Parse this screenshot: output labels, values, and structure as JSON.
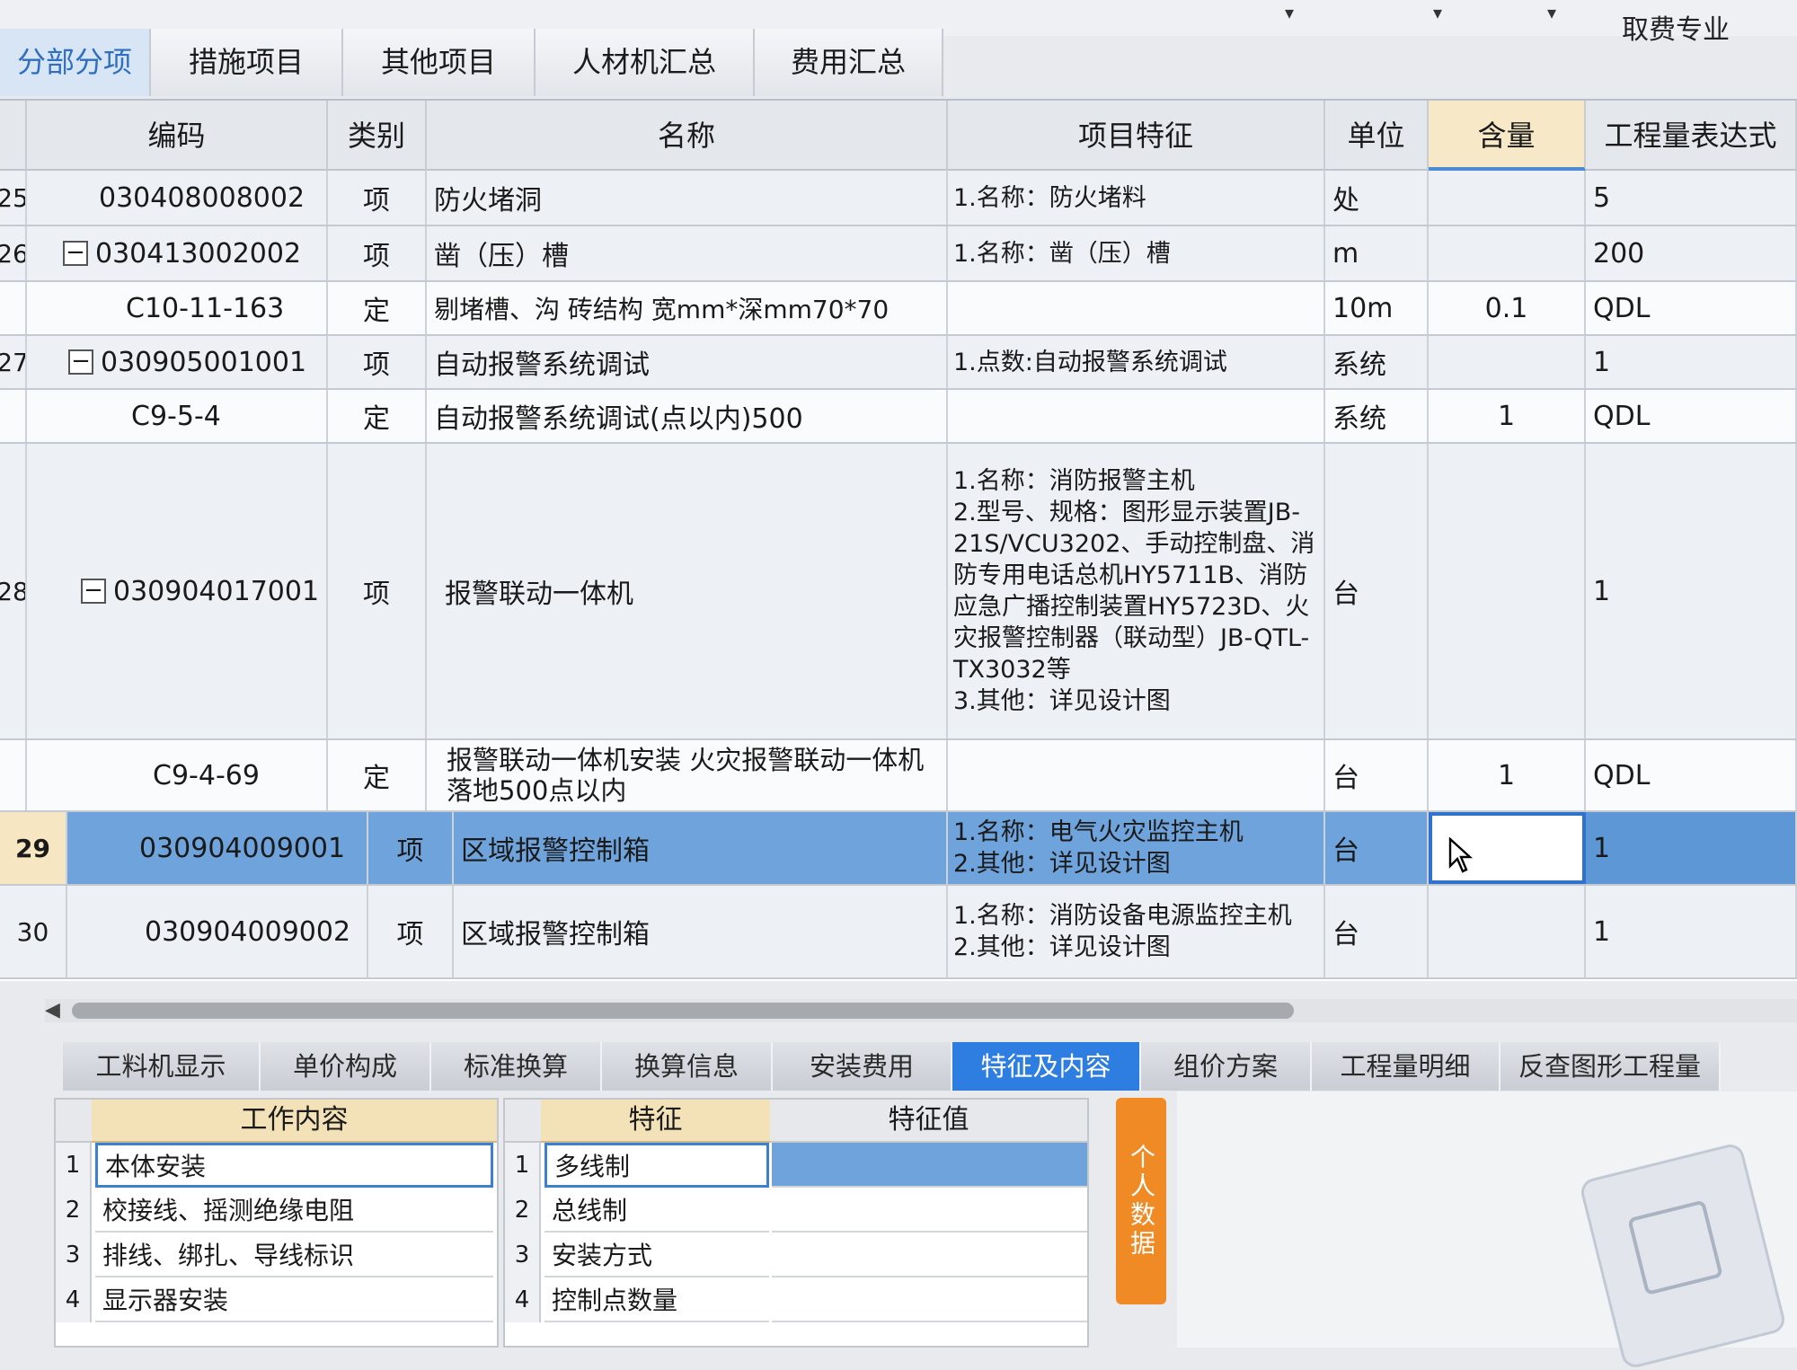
{
  "top": {
    "fee_label": "取费专业"
  },
  "tabs": [
    {
      "label": "分部分项",
      "active": true
    },
    {
      "label": "措施项目"
    },
    {
      "label": "其他项目"
    },
    {
      "label": "人材机汇总"
    },
    {
      "label": "费用汇总"
    }
  ],
  "table": {
    "headers": {
      "code": "编码",
      "type": "类别",
      "name": "名称",
      "feature": "项目特征",
      "unit": "单位",
      "content": "含量",
      "expr": "工程量表达式"
    },
    "rows": [
      {
        "num": "25",
        "code": "030408008002",
        "type": "项",
        "name": "防火堵洞",
        "feature": "1.名称：防火堵料",
        "unit": "处",
        "content": "",
        "expr": "5"
      },
      {
        "num": "26",
        "code": "030413002002",
        "type": "项",
        "name": "凿（压）槽",
        "feature": "1.名称：凿（压）槽",
        "unit": "m",
        "content": "",
        "expr": "200"
      },
      {
        "num": "",
        "code": "C10-11-163",
        "type": "定",
        "name": "剔堵槽、沟 砖结构 宽mm*深mm70*70",
        "feature": "",
        "unit": "10m",
        "content": "0.1",
        "expr": "QDL"
      },
      {
        "num": "27",
        "code": "030905001001",
        "type": "项",
        "name": "自动报警系统调试",
        "feature": "1.点数:自动报警系统调试",
        "unit": "系统",
        "content": "",
        "expr": "1"
      },
      {
        "num": "",
        "code": "C9-5-4",
        "type": "定",
        "name": "自动报警系统调试(点以内)500",
        "feature": "",
        "unit": "系统",
        "content": "1",
        "expr": "QDL"
      },
      {
        "num": "28",
        "code": "030904017001",
        "type": "项",
        "name": "报警联动一体机",
        "feature": "1.名称：消防报警主机\n2.型号、规格：图形显示装置JB-21S/VCU3202、手动控制盘、消防专用电话总机HY5711B、消防应急广播控制装置HY5723D、火灾报警控制器（联动型）JB-QTL-TX3032等\n3.其他：详见设计图",
        "unit": "台",
        "content": "",
        "expr": "1"
      },
      {
        "num": "",
        "code": "C9-4-69",
        "type": "定",
        "name": "报警联动一体机安装 火灾报警联动一体机落地500点以内",
        "feature": "",
        "unit": "台",
        "content": "1",
        "expr": "QDL"
      },
      {
        "num": "29",
        "code": "030904009001",
        "type": "项",
        "name": "区域报警控制箱",
        "feature": "1.名称：电气火灾监控主机\n2.其他：详见设计图",
        "unit": "台",
        "content": "",
        "expr": "1"
      },
      {
        "num": "30",
        "code": "030904009002",
        "type": "项",
        "name": "区域报警控制箱",
        "feature": "1.名称：消防设备电源监控主机\n2.其他：详见设计图",
        "unit": "台",
        "content": "",
        "expr": "1"
      }
    ]
  },
  "bottom_tabs": [
    {
      "label": "工料机显示"
    },
    {
      "label": "单价构成"
    },
    {
      "label": "标准换算"
    },
    {
      "label": "换算信息"
    },
    {
      "label": "安装费用"
    },
    {
      "label": "特征及内容",
      "active": true
    },
    {
      "label": "组价方案"
    },
    {
      "label": "工程量明细"
    },
    {
      "label": "反查图形工程量"
    }
  ],
  "work_content": {
    "header": "工作内容",
    "items": [
      {
        "num": "1",
        "text": "本体安装"
      },
      {
        "num": "2",
        "text": "校接线、摇测绝缘电阻"
      },
      {
        "num": "3",
        "text": "排线、绑扎、导线标识"
      },
      {
        "num": "4",
        "text": "显示器安装"
      }
    ]
  },
  "features": {
    "header_feature": "特征",
    "header_value": "特征值",
    "items": [
      {
        "num": "1",
        "text": "多线制"
      },
      {
        "num": "2",
        "text": "总线制"
      },
      {
        "num": "3",
        "text": "安装方式"
      },
      {
        "num": "4",
        "text": "控制点数量"
      }
    ]
  },
  "side_button": "个人数据"
}
